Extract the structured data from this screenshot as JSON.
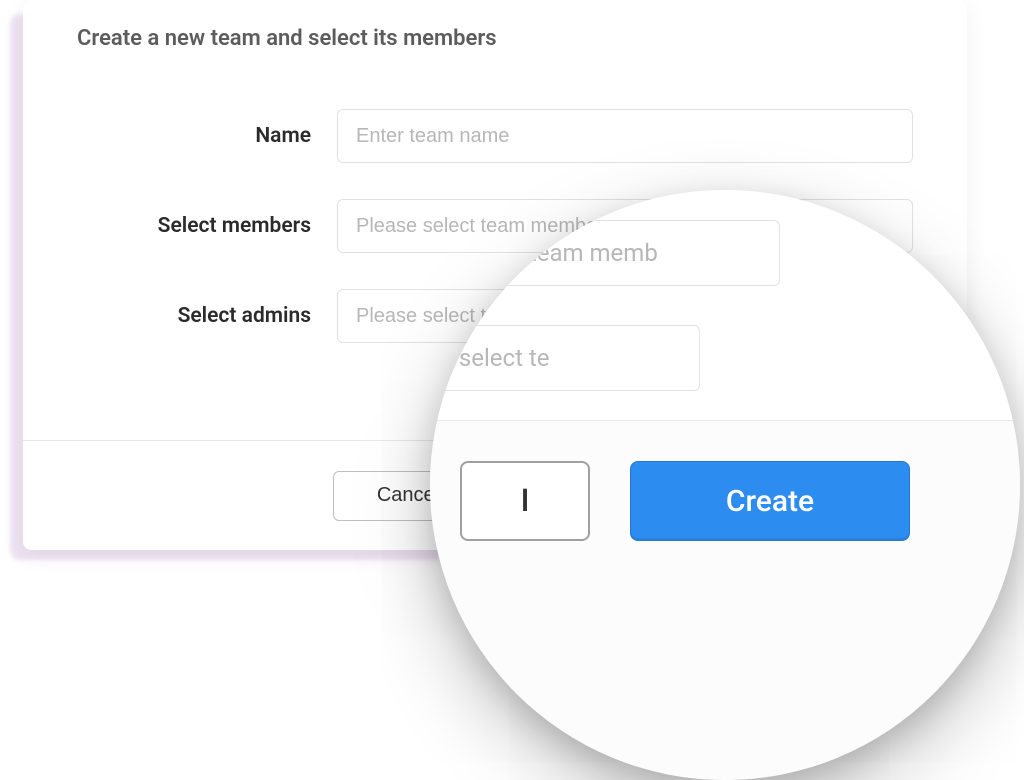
{
  "modal": {
    "title": "Create a new team and select its members",
    "fields": {
      "name": {
        "label": "Name",
        "placeholder": "Enter team name",
        "value": ""
      },
      "members": {
        "label": "Select members",
        "placeholder": "Please select team members",
        "value": ""
      },
      "admins": {
        "label": "Select admins",
        "placeholder": "Please select team admins",
        "value": ""
      }
    },
    "footer": {
      "cancel_label": "Cancel",
      "create_label": "Create"
    }
  },
  "magnified": {
    "cancel_fragment": "l",
    "create_label": "Create",
    "members_placeholder_fragment": "Please select team memb",
    "admins_placeholder_fragment": "Please select te"
  },
  "colors": {
    "accent_primary": "#2d8cf0",
    "shadow_tint": "#e0cce8",
    "text_heading": "#5c5c5c",
    "text_label": "#2b2b2b",
    "placeholder": "#b7b7b7",
    "border": "#e2e2e2"
  }
}
